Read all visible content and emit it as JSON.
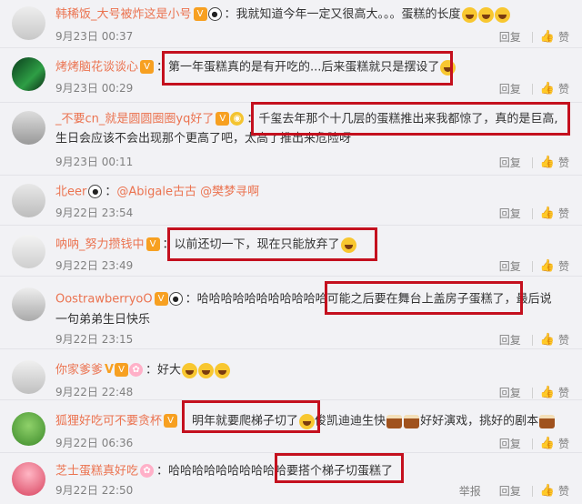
{
  "actions": {
    "reply": "回复",
    "like": "赞",
    "report": "举报"
  },
  "comments": [
    {
      "user": "韩稀饭_大号被炸这是小号",
      "badges": [
        "vip",
        "panda"
      ],
      "text": "我就知道今年一定又很高大。。。蛋糕的长度",
      "emoji_count": 3,
      "time": "9月23日 00:37"
    },
    {
      "user": "烤烤脑花谈谈心",
      "badges": [
        "vip"
      ],
      "text": "第一年蛋糕真的是有开吃的...后来蛋糕就只是摆设了",
      "emoji_count": 1,
      "time": "9月23日 00:29"
    },
    {
      "user": "_不要cn_就是圆圆圈圈yq好了",
      "badges": [
        "vip",
        "bulb"
      ],
      "text1": "千玺去年那个十几层的蛋糕推出来我都惊了，真的是巨高,",
      "text2": "生日会应该不会出现那个更高了吧，太高了推出来危险呀",
      "time": "9月23日 00:11"
    },
    {
      "user": "北eer",
      "badges": [
        "panda"
      ],
      "mention1": "@Abigale古古",
      "mention2": "@樊梦寻啊",
      "time": "9月22日 23:54"
    },
    {
      "user": "呐呐_努力攒钱中",
      "badges": [
        "vip"
      ],
      "text": "以前还切一下，现在只能放弃了",
      "emoji_count": 1,
      "time": "9月22日 23:49"
    },
    {
      "user": "OostrawberryoO",
      "badges": [
        "vip",
        "panda"
      ],
      "text_prefix": "哈哈哈哈哈哈哈哈哈哈哈",
      "text_boxed": "可能之后要在舞台上盖房子蛋糕了",
      "text_suffix": "，最后说",
      "text2": "一句弟弟生日快乐",
      "time": "9月22日 23:15"
    },
    {
      "user": "你家爹爹",
      "badges": [
        "v",
        "vip",
        "flower"
      ],
      "text": "好大",
      "emoji_count": 3,
      "time": "9月22日 22:48"
    },
    {
      "user": "狐狸好吃可不要贪杯",
      "badges": [
        "vip"
      ],
      "text_boxed": "明年就要爬梯子切了",
      "text_mid": "俊凯迪迪生快",
      "text_end": "好好演戏，挑好的剧本",
      "time": "9月22日 06:36"
    },
    {
      "user": "芝士蛋糕真好吃",
      "badges": [
        "flower"
      ],
      "text_prefix": "哈哈哈哈哈哈哈哈哈哈",
      "text_boxed": "要搭个梯子切蛋糕了",
      "time": "9月22日 22:50"
    }
  ]
}
